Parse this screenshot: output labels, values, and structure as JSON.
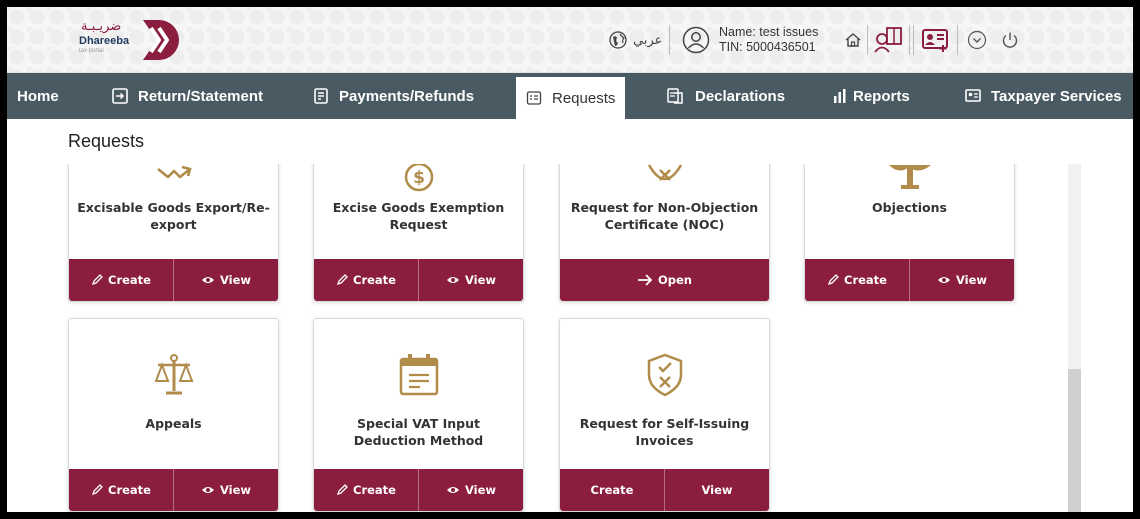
{
  "header": {
    "logo_arabic": "ضريـبـة",
    "logo_name": "Dhareeba",
    "logo_tagline": "tax portal",
    "language_label": "عربي",
    "user_name": "Name: test issues",
    "user_tin": "TIN: 5000436501",
    "brand_color": "#8b1d3f"
  },
  "nav": {
    "items": [
      {
        "label": "Home",
        "icon": ""
      },
      {
        "label": "Return/Statement",
        "icon": "return-icon"
      },
      {
        "label": "Payments/Refunds",
        "icon": "payments-icon"
      },
      {
        "label": "Requests",
        "icon": "requests-icon"
      },
      {
        "label": "Declarations",
        "icon": "declarations-icon"
      },
      {
        "label": "Reports",
        "icon": "reports-icon"
      },
      {
        "label": "Taxpayer Services",
        "icon": "taxpayer-services-icon"
      }
    ],
    "active": "Requests"
  },
  "page": {
    "title": "Requests"
  },
  "cards": [
    {
      "title": "Excisable Goods Export/Re-export",
      "icon": "export-icon",
      "actions": [
        "Create",
        "View"
      ]
    },
    {
      "title": "Excise Goods Exemption Request",
      "icon": "dollar-icon",
      "actions": [
        "Create",
        "View"
      ]
    },
    {
      "title": "Request for Non-Objection Certificate (NOC)",
      "icon": "x-shield-icon",
      "actions": [
        "Open"
      ]
    },
    {
      "title": "Objections",
      "icon": "scale-icon",
      "actions": [
        "Create",
        "View"
      ]
    },
    {
      "title": "Appeals",
      "icon": "scale-icon",
      "actions": [
        "Create",
        "View"
      ]
    },
    {
      "title": "Special VAT Input Deduction Method",
      "icon": "calendar-doc-icon",
      "actions": [
        "Create",
        "View"
      ]
    },
    {
      "title": "Request for Self-Issuing Invoices",
      "icon": "check-x-shield-icon",
      "actions": [
        "Create",
        "View"
      ]
    }
  ]
}
